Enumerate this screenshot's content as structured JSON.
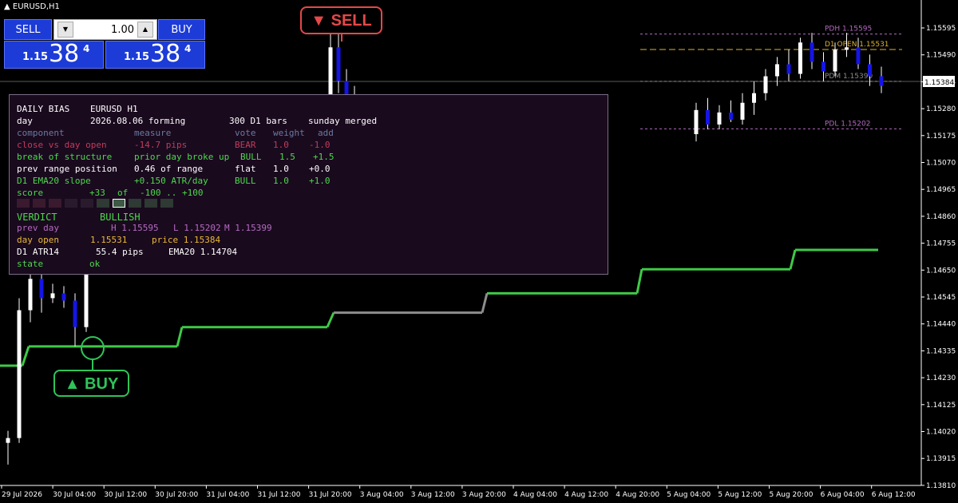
{
  "window": {
    "symbol": "EURUSD,H1"
  },
  "trade_panel": {
    "sell_label": "SELL",
    "buy_label": "BUY",
    "lot_value": "1.00",
    "bid": {
      "prefix": "1.15",
      "big": "38",
      "sup": "4"
    },
    "ask": {
      "prefix": "1.15",
      "big": "38",
      "sup": "4"
    }
  },
  "signals": {
    "sell": "▼ SELL",
    "buy": "▲ BUY"
  },
  "levels": {
    "pdh": "PDH 1.15595",
    "d1_open": "D1 OPEN 1.15531",
    "pdm": "PDM 1.15399",
    "pdl": "PDL 1.15202",
    "current_price": "1.15384"
  },
  "colors": {
    "bull_body": "#ffffff",
    "bear_body": "#1515e6",
    "wick": "#ffffff",
    "ema_bull": "#3fc947",
    "ema_flat": "#8d8d8d",
    "level_line": "#b36bc0",
    "open_line": "#e0b030",
    "panel_bg": "#1a0a1e",
    "bullish": "#4cd94c",
    "bearish": "#c03c5c",
    "header": "#ffffff",
    "muted": "#6b7aa0",
    "purple": "#b36bc0",
    "gold": "#e8b838"
  },
  "chart_data": {
    "type": "candlestick",
    "title": "EURUSD,H1",
    "y_ticks": [
      "1.15595",
      "1.15490",
      "1.15384",
      "1.15280",
      "1.15175",
      "1.15070",
      "1.14965",
      "1.14860",
      "1.14755",
      "1.14650",
      "1.14545",
      "1.14440",
      "1.14335",
      "1.14230",
      "1.14125",
      "1.14020",
      "1.13915",
      "1.13810"
    ],
    "x_ticks": [
      "29 Jul 2026",
      "30 Jul 04:00",
      "30 Jul 12:00",
      "30 Jul 20:00",
      "31 Jul 04:00",
      "31 Jul 12:00",
      "31 Jul 20:00",
      "3 Aug 04:00",
      "3 Aug 12:00",
      "3 Aug 20:00",
      "4 Aug 04:00",
      "4 Aug 12:00",
      "4 Aug 20:00",
      "5 Aug 04:00",
      "5 Aug 12:00",
      "5 Aug 20:00",
      "6 Aug 04:00",
      "6 Aug 12:00"
    ],
    "ylim": [
      1.1375,
      1.1567
    ],
    "levels": {
      "pdh": 1.15595,
      "d1_open": 1.15531,
      "pdm": 1.15399,
      "pdl": 1.15202,
      "current": 1.15384
    },
    "ema20_steps": [
      {
        "from": "29 Jul",
        "value": 1.1422,
        "state": "bull"
      },
      {
        "from": "30 Jul",
        "value": 1.143,
        "state": "bull"
      },
      {
        "from": "31 Jul",
        "value": 1.1438,
        "state": "bull"
      },
      {
        "from": "3 Aug",
        "value": 1.1444,
        "state": "flat"
      },
      {
        "from": "4 Aug",
        "value": 1.1452,
        "state": "bull"
      },
      {
        "from": "5 Aug",
        "value": 1.1462,
        "state": "bull"
      },
      {
        "from": "6 Aug",
        "value": 1.147,
        "state": "bull"
      }
    ],
    "candles_visible": [
      {
        "o": 1.139,
        "h": 1.1395,
        "l": 1.1381,
        "c": 1.1392
      },
      {
        "o": 1.1392,
        "h": 1.145,
        "l": 1.139,
        "c": 1.1445
      },
      {
        "o": 1.1445,
        "h": 1.1465,
        "l": 1.144,
        "c": 1.1458
      },
      {
        "o": 1.1458,
        "h": 1.1462,
        "l": 1.1444,
        "c": 1.145
      },
      {
        "o": 1.145,
        "h": 1.1456,
        "l": 1.1448,
        "c": 1.1452
      },
      {
        "o": 1.1452,
        "h": 1.1455,
        "l": 1.1446,
        "c": 1.1449
      },
      {
        "o": 1.1449,
        "h": 1.1452,
        "l": 1.143,
        "c": 1.1438
      },
      {
        "o": 1.1438,
        "h": 1.1468,
        "l": 1.1436,
        "c": 1.1465
      },
      {
        "o": 1.1465,
        "h": 1.1472,
        "l": 1.1462,
        "c": 1.147
      }
    ],
    "candles_right": [
      {
        "o": 1.1518,
        "h": 1.1531,
        "l": 1.1515,
        "c": 1.1528
      },
      {
        "o": 1.1528,
        "h": 1.1533,
        "l": 1.152,
        "c": 1.1522
      },
      {
        "o": 1.1522,
        "h": 1.153,
        "l": 1.152,
        "c": 1.1527
      },
      {
        "o": 1.1527,
        "h": 1.1532,
        "l": 1.1523,
        "c": 1.1524
      },
      {
        "o": 1.1524,
        "h": 1.1535,
        "l": 1.1522,
        "c": 1.1531
      },
      {
        "o": 1.1531,
        "h": 1.154,
        "l": 1.1526,
        "c": 1.1535
      },
      {
        "o": 1.1535,
        "h": 1.1545,
        "l": 1.1532,
        "c": 1.1542
      },
      {
        "o": 1.1542,
        "h": 1.155,
        "l": 1.1538,
        "c": 1.1547
      },
      {
        "o": 1.1547,
        "h": 1.1553,
        "l": 1.154,
        "c": 1.1543
      },
      {
        "o": 1.1543,
        "h": 1.1558,
        "l": 1.1541,
        "c": 1.1556
      },
      {
        "o": 1.1556,
        "h": 1.156,
        "l": 1.1545,
        "c": 1.1548
      },
      {
        "o": 1.1548,
        "h": 1.1552,
        "l": 1.154,
        "c": 1.1544
      },
      {
        "o": 1.1544,
        "h": 1.1556,
        "l": 1.1542,
        "c": 1.1553
      },
      {
        "o": 1.1553,
        "h": 1.156,
        "l": 1.155,
        "c": 1.1554
      },
      {
        "o": 1.1554,
        "h": 1.1558,
        "l": 1.1545,
        "c": 1.1547
      },
      {
        "o": 1.1547,
        "h": 1.1551,
        "l": 1.1538,
        "c": 1.1542
      },
      {
        "o": 1.1542,
        "h": 1.1546,
        "l": 1.1535,
        "c": 1.1538
      }
    ]
  },
  "bias_panel": {
    "title": "DAILY BIAS",
    "symbol": "EURUSD H1",
    "day_label": "day",
    "day_value": "2026.08.06 forming",
    "bars_info": "300 D1 bars",
    "merge_info": "sunday merged",
    "headers": {
      "component": "component",
      "measure": "measure",
      "vote": "vote",
      "weight": "weight",
      "add": "add"
    },
    "rows": [
      {
        "component": "close vs day open",
        "measure": "-14.7 pips",
        "vote": "BEAR",
        "weight": "1.0",
        "add": "-1.0",
        "tone": "bear"
      },
      {
        "component": "break of structure",
        "measure": "prior day broke up",
        "vote": "BULL",
        "weight": "1.5",
        "add": "+1.5",
        "tone": "bull"
      },
      {
        "component": "prev range position",
        "measure": "0.46 of range",
        "vote": "flat",
        "weight": "1.0",
        "add": "+0.0",
        "tone": "flat"
      },
      {
        "component": "D1 EMA20 slope",
        "measure": "+0.150 ATR/day",
        "vote": "BULL",
        "weight": "1.0",
        "add": "+1.0",
        "tone": "bull"
      }
    ],
    "score": {
      "label": "score",
      "value": "+33",
      "of": "of",
      "range": "-100 .. +100",
      "fraction": 0.665
    },
    "verdict": {
      "label": "VERDICT",
      "value": "BULLISH"
    },
    "prev_day": {
      "label": "prev day",
      "h": "H 1.15595",
      "l": "L 1.15202",
      "m": "M 1.15399"
    },
    "day_open": {
      "label": "day open",
      "value": "1.15531",
      "price": "price 1.15384"
    },
    "atr": {
      "label": "D1 ATR14",
      "value": "55.4 pips",
      "ema": "EMA20 1.14704"
    },
    "state": {
      "label": "state",
      "value": "ok"
    }
  }
}
